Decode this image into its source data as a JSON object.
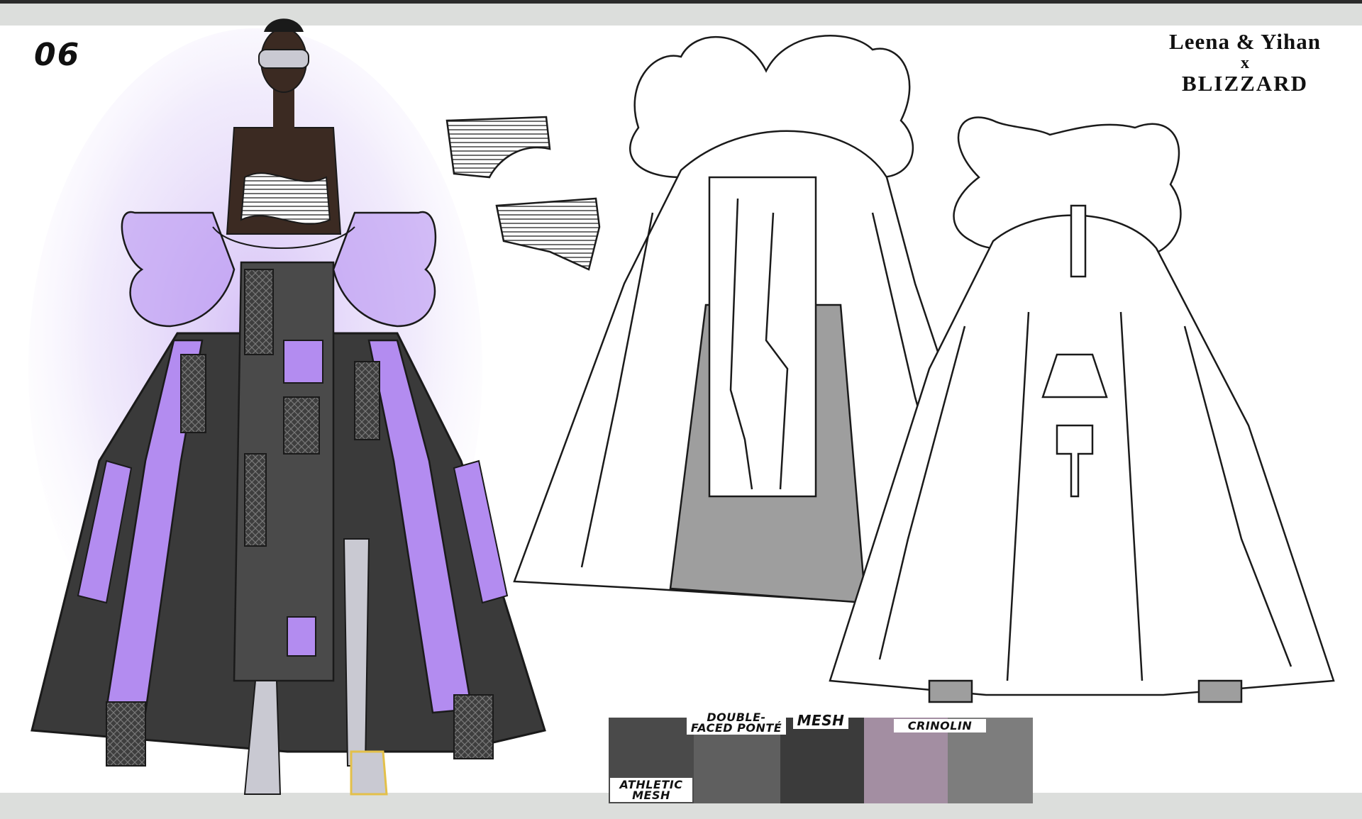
{
  "sheet": {
    "number": "06",
    "brand": {
      "line1": "Leena & Yihan",
      "line2": "x",
      "line3": "BLIZZARD"
    }
  },
  "colors": {
    "accent_lilac": "#b38cf0",
    "dark_panel": "#3a3a3a",
    "mid_grey": "#8a8a8a",
    "skin": "#3b2a22",
    "outline": "#1a1a1a",
    "chrome": "#c9c9d2"
  },
  "materials": [
    {
      "label": "ATHLETIC MESH",
      "color": "#4a4a4a"
    },
    {
      "label": "DOUBLE-FACED PONTÉ",
      "color": "#5f5f5f"
    },
    {
      "label": "MESH",
      "color": "#3b3b3b"
    },
    {
      "label": "",
      "color": "#a38ea2"
    },
    {
      "label": "CRINOLIN",
      "color": "#7d7d7d"
    }
  ],
  "figures": [
    {
      "name": "color-illustration"
    },
    {
      "name": "flat-sketch-front"
    },
    {
      "name": "flat-sketch-back"
    },
    {
      "name": "bodice-detail-sketches"
    }
  ]
}
